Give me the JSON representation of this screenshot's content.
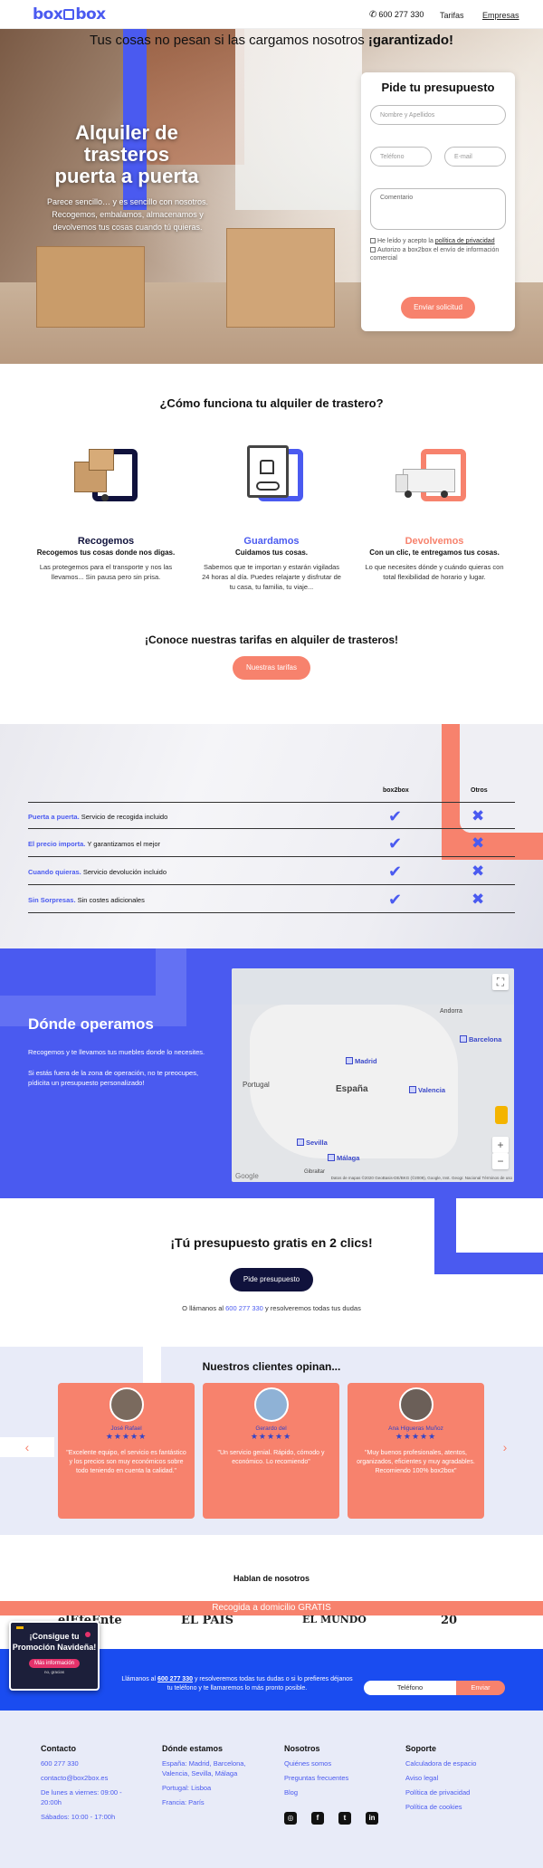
{
  "header": {
    "logo_left": "box",
    "logo_right": "box",
    "phone": "600 277 330",
    "nav_tarifas": "Tarifas",
    "nav_empresas": "Empresas"
  },
  "hero": {
    "title": "Alquiler de trasteros puerta a puerta",
    "subtitle": "Parece sencillo… y es sencillo con nosotros. Recogemos, embalamos, almacenamos y devolvemos tus cosas cuando tú quieras.",
    "form": {
      "title": "Pide tu presupuesto",
      "name_placeholder": "Nombre y Apellidos",
      "phone_placeholder": "Teléfono",
      "email_placeholder": "E-mail",
      "comment_label": "Comentario",
      "privacy_prefix": "He leído y acepto la",
      "privacy_link": "política de privacidad",
      "consent": "Autorizo a box2box el envío de información comercial",
      "submit": "Enviar solicitud"
    }
  },
  "how": {
    "title": "¿Cómo funciona tu alquiler de trastero?",
    "steps": [
      {
        "title": "Recogemos",
        "subtitle": "Recogemos tus cosas donde nos digas.",
        "desc": "Las protegemos para el transporte y nos las llevamos... Sin pausa pero sin prisa.",
        "color": "#10123c"
      },
      {
        "title": "Guardamos",
        "subtitle": "Cuidamos tus cosas.",
        "desc": "Sabemos que te importan y estarán vigiladas 24 horas al día. Puedes relajarte y disfrutar de tu casa, tu familia, tu viaje...",
        "color": "#4a5af0"
      },
      {
        "title": "Devolvemos",
        "subtitle": "Con un clic, te entregamos tus cosas.",
        "desc": "Lo que necesites dónde y cuándo quieras con total flexibilidad de horario y lugar.",
        "color": "#f7826d"
      }
    ],
    "tarifas_title": "¡Conoce nuestras tarifas en alquiler de trasteros!",
    "tarifas_button": "Nuestras tarifas"
  },
  "guarantee": {
    "title_plain": "Tus cosas no pesan si las cargamos nosotros",
    "title_bold": "¡garantizado!",
    "col_a": "box2box",
    "col_b": "Otros",
    "rows": [
      {
        "bold": "Puerta a puerta.",
        "text": "Servicio de recogida incluido"
      },
      {
        "bold": "El precio importa.",
        "text": "Y garantizamos el mejor"
      },
      {
        "bold": "Cuando quieras.",
        "text": "Servicio devolución incluido"
      },
      {
        "bold": "Sin Sorpresas.",
        "text": "Sin costes adicionales"
      }
    ]
  },
  "where": {
    "title": "Dónde operamos",
    "p1": "Recogemos y te llevamos tus muebles donde lo necesites.",
    "p2": "Si estás fuera de la zona de operación, no te preocupes, pídicita un presupuesto personalizado!",
    "map": {
      "country": "España",
      "portugal": "Portugal",
      "andorra": "Andorra",
      "gibraltar": "Gibraltar",
      "google": "Google",
      "attribution": "Datos de mapas ©2020 GeoBasis-DE/BKG (©2009), Google, Inst. Geogr. Nacional   Términos de uso",
      "cities": [
        "Madrid",
        "Barcelona",
        "Valencia",
        "Sevilla",
        "Málaga"
      ]
    }
  },
  "cta": {
    "title": "¡Tú presupuesto gratis en 2 clics!",
    "button": "Pide presupuesto",
    "line_prefix": "O llámanos al",
    "line_phone": "600 277 330",
    "line_suffix": "y resolveremos todas tus dudas"
  },
  "testimonials": {
    "title": "Nuestros clientes opinan...",
    "items": [
      {
        "name": "José Rafael",
        "stars": "★★★★★",
        "quote": "\"Excelente equipo, el servicio es fantástico y los precios son muy económicos sobre todo teniendo en cuenta la calidad.\""
      },
      {
        "name": "Gerardo del",
        "stars": "★★★★★",
        "quote": "\"Un servicio genial. Rápido, cómodo y económico. Lo recomiendo\""
      },
      {
        "name": "Ana Higueras Muñoz",
        "stars": "★★★★★",
        "quote": "\"Muy buenos profesionales, atentos, organizados, eficientes y muy agradables. Recomiendo 100% box2box\""
      }
    ]
  },
  "press": {
    "title": "Hablan de nosotros",
    "banner": "Recogida a domicilio GRATIS",
    "logos": [
      "elEfeEnte",
      "EL PAÍS",
      "EL MUNDO",
      "20"
    ]
  },
  "band": {
    "text_prefix": "Llámanos al",
    "phone": "600 277 330",
    "text_suffix": "y resolveremos todas tus dudas o si lo prefieres déjanos tu teléfono y te llamaremos lo más pronto posible.",
    "input_placeholder": "Teléfono",
    "button": "Enviar"
  },
  "promo": {
    "text": "¡Consigue tu Promoción Navideña!",
    "button": "Más información",
    "dismiss": "no, gracias"
  },
  "footer": {
    "contacto": {
      "title": "Contacto",
      "items": [
        "600 277 330",
        "contacto@box2box.es",
        "De lunes a viernes: 09:00 - 20:00h",
        "Sábados: 10:00 - 17:00h"
      ]
    },
    "donde": {
      "title": "Dónde estamos",
      "items": [
        "España: Madrid, Barcelona, Valencia, Sevilla, Málaga",
        "Portugal: Lisboa",
        "Francia: París"
      ]
    },
    "nosotros": {
      "title": "Nosotros",
      "items": [
        "Quiénes somos",
        "Preguntas frecuentes",
        "Blog"
      ]
    },
    "soporte": {
      "title": "Soporte",
      "items": [
        "Calculadora de espacio",
        "Aviso legal",
        "Política de privacidad",
        "Política de cookies"
      ]
    }
  }
}
